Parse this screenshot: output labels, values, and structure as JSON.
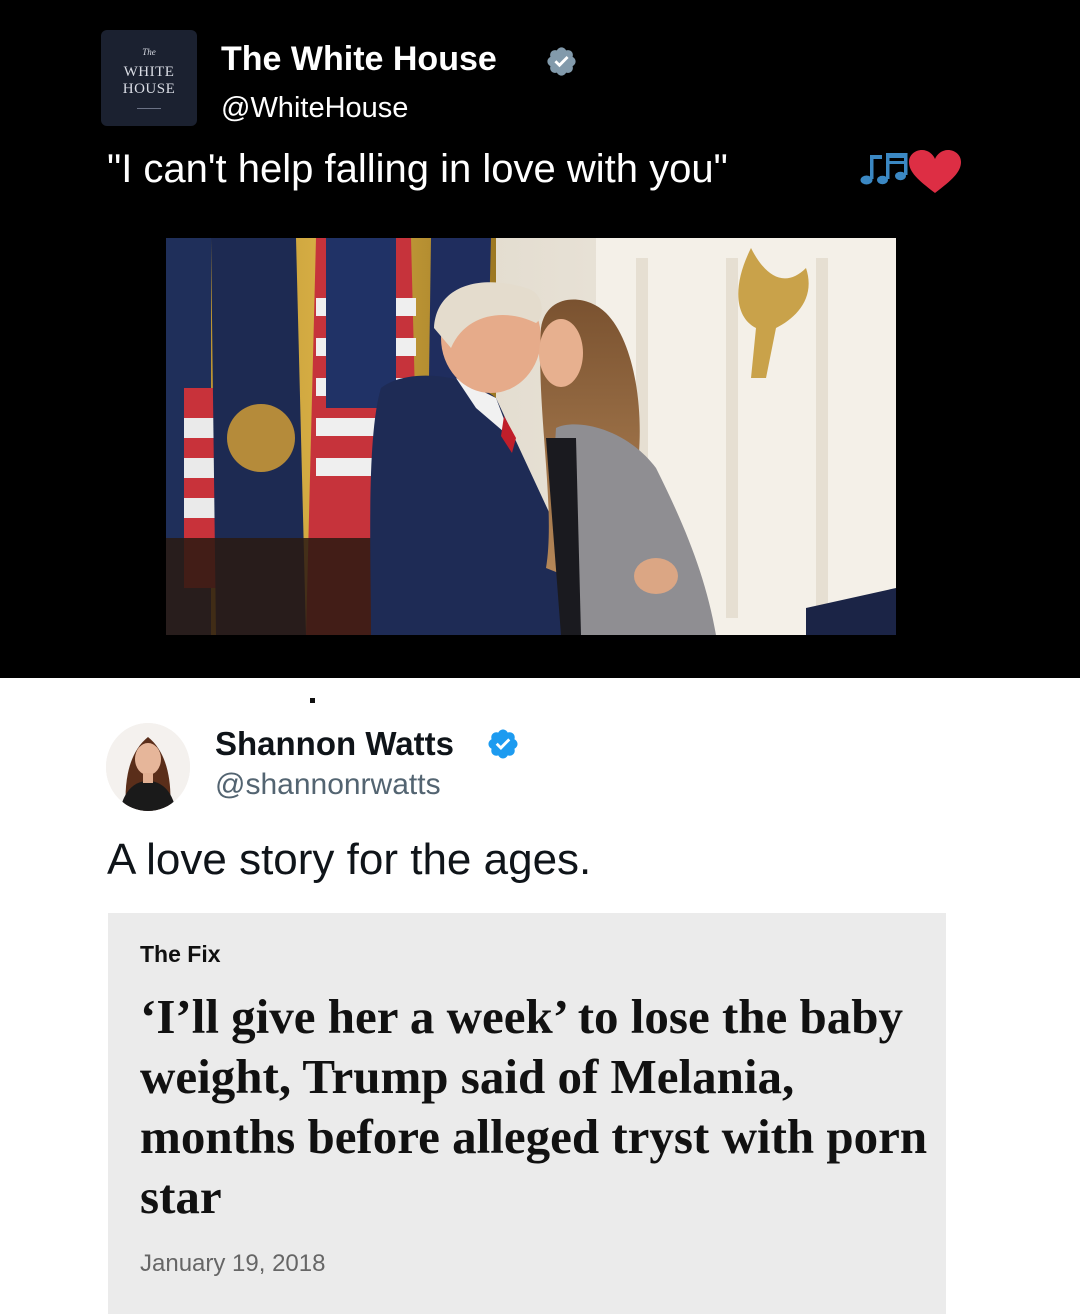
{
  "top_tweet": {
    "avatar_lines": [
      "The",
      "WHITE",
      "HOUSE"
    ],
    "display_name": "The White House",
    "handle": "@WhiteHouse",
    "text": "\"I can't help falling in love with you\"",
    "photo_alt": "Couple embracing in front of flags"
  },
  "bottom_tweet": {
    "display_name": "Shannon Watts",
    "handle": "@shannonrwatts",
    "text": "A love story for the ages.",
    "card": {
      "section": "The Fix",
      "headline": "‘I’ll give her a week’ to lose the baby weight, Trump said of Melania, months before alleged tryst with porn star",
      "date": "January 19, 2018"
    }
  },
  "colors": {
    "verified_blue": "#1d9bf0",
    "verified_gray": "#829aab",
    "heart_red": "#dd2e44",
    "music_blue": "#3b88c3"
  }
}
